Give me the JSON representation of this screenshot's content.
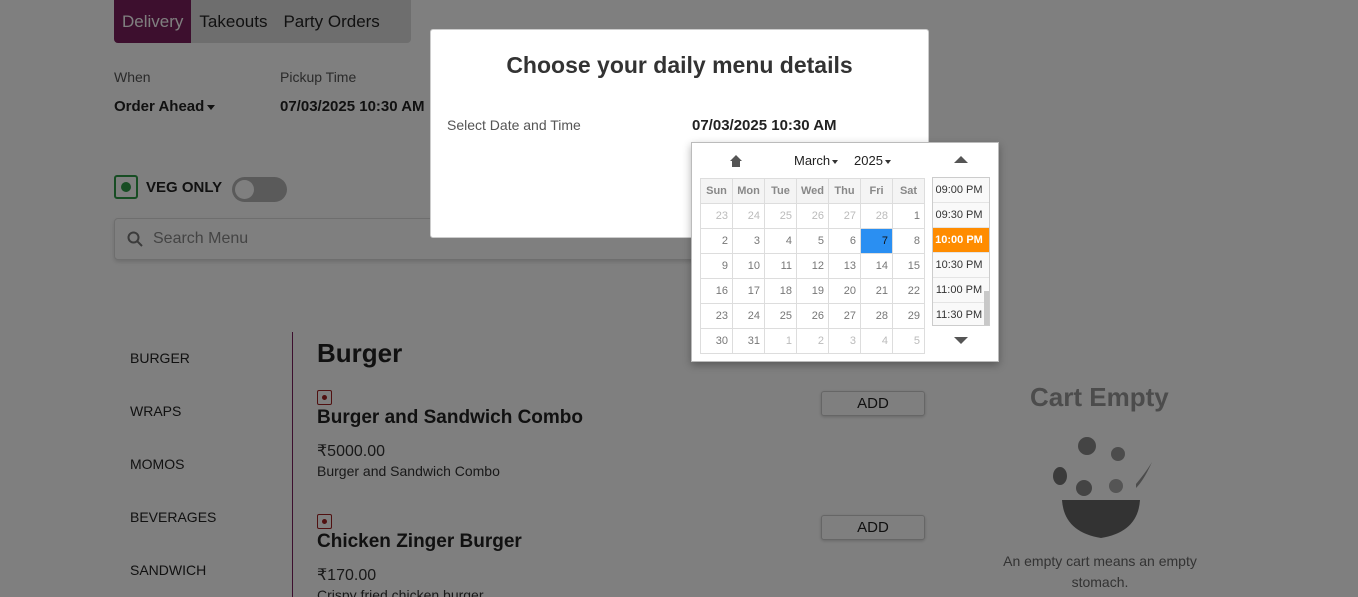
{
  "tabs": [
    "Delivery",
    "Takeouts",
    "Party Orders"
  ],
  "when": {
    "label": "When",
    "value": "Order Ahead"
  },
  "pickup": {
    "label": "Pickup Time",
    "value": "07/03/2025 10:30 AM"
  },
  "veg": {
    "label": "VEG ONLY"
  },
  "search": {
    "placeholder": "Search Menu"
  },
  "categories": [
    "BURGER",
    "WRAPS",
    "MOMOS",
    "BEVERAGES",
    "SANDWICH"
  ],
  "section": {
    "title": "Burger"
  },
  "items": [
    {
      "name": "Burger and Sandwich Combo",
      "price": "₹5000.00",
      "desc": "Burger and Sandwich Combo",
      "add": "ADD"
    },
    {
      "name": "Chicken Zinger Burger",
      "price": "₹170.00",
      "desc": "Crispy fried chicken burger",
      "add": "ADD"
    }
  ],
  "cart": {
    "title": "Cart Empty",
    "text": "An empty cart means an empty stomach."
  },
  "modal": {
    "title": "Choose your daily menu details",
    "label": "Select Date and Time",
    "value": "07/03/2025 10:30 AM"
  },
  "picker": {
    "month": "March",
    "year": "2025",
    "weekdays": [
      "Sun",
      "Mon",
      "Tue",
      "Wed",
      "Thu",
      "Fri",
      "Sat"
    ],
    "weeks": [
      [
        "23",
        "24",
        "25",
        "26",
        "27",
        "28",
        "1"
      ],
      [
        "2",
        "3",
        "4",
        "5",
        "6",
        "7",
        "8"
      ],
      [
        "9",
        "10",
        "11",
        "12",
        "13",
        "14",
        "15"
      ],
      [
        "16",
        "17",
        "18",
        "19",
        "20",
        "21",
        "22"
      ],
      [
        "23",
        "24",
        "25",
        "26",
        "27",
        "28",
        "29"
      ],
      [
        "30",
        "31",
        "1",
        "2",
        "3",
        "4",
        "5"
      ]
    ],
    "selected_day": "7",
    "times": [
      "09:00 PM",
      "09:30 PM",
      "10:00 PM",
      "10:30 PM",
      "11:00 PM",
      "11:30 PM"
    ],
    "selected_time": "10:00 PM"
  },
  "colors": {
    "accent": "#7a1f5c",
    "veg": "#2e9a47",
    "nonveg": "#a02020",
    "selected_day": "#2a8ff2",
    "selected_time": "#ff8c00"
  }
}
